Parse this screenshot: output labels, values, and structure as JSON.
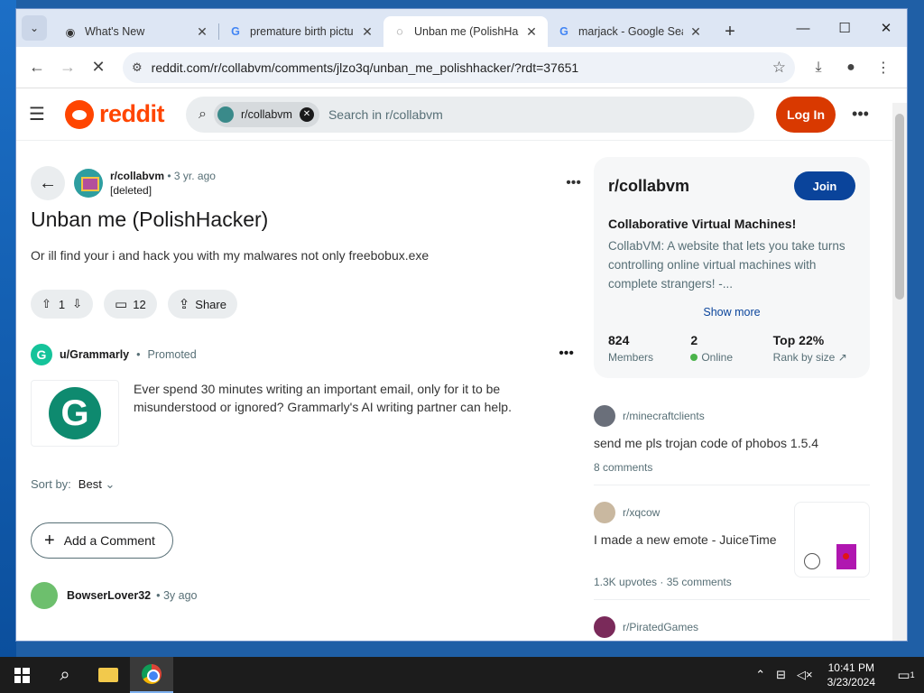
{
  "browser": {
    "tabs": [
      {
        "title": "What's New",
        "active": false
      },
      {
        "title": "premature birth pictu",
        "active": false
      },
      {
        "title": "Unban me (PolishHac",
        "active": true
      },
      {
        "title": "marjack - Google Sea",
        "active": false
      }
    ],
    "url": "reddit.com/r/collabvm/comments/jlzo3q/unban_me_polishhacker/?rdt=37651"
  },
  "reddit": {
    "logo_text": "reddit",
    "search_chip": "r/collabvm",
    "search_placeholder": "Search in r/collabvm",
    "login_label": "Log In"
  },
  "post": {
    "subreddit": "r/collabvm",
    "time": "• 3 yr. ago",
    "author": "[deleted]",
    "title": "Unban me (PolishHacker)",
    "body": "Or ill find your i and hack you with my malwares not only freebobux.exe",
    "votes": "1",
    "comments": "12",
    "share_label": "Share"
  },
  "promo": {
    "user": "u/Grammarly",
    "dot": "•",
    "tag": "Promoted",
    "logo_letter": "G",
    "text": "Ever spend 30 minutes writing an important email, only for it to be misunderstood or ignored? Grammarly's AI writing partner can help."
  },
  "sort": {
    "label": "Sort by:",
    "value": "Best"
  },
  "add_comment_label": "Add a Comment",
  "comment": {
    "user": "BowserLover32",
    "time": "• 3y ago"
  },
  "sidebar": {
    "name": "r/collabvm",
    "join_label": "Join",
    "headline": "Collaborative Virtual Machines!",
    "description": "CollabVM: A website that lets you take turns controlling online virtual machines with complete strangers! -...",
    "show_more": "Show more",
    "stats": [
      {
        "value": "824",
        "label": "Members"
      },
      {
        "value": "2",
        "label": "Online"
      },
      {
        "value": "Top 22%",
        "label": "Rank by size"
      }
    ]
  },
  "feed": [
    {
      "sub": "r/minecraftclients",
      "title": "send me pls trojan code of phobos 1.5.4",
      "meta": "8 comments",
      "avatar_color": "#6a6f7a"
    },
    {
      "sub": "r/xqcow",
      "title": "I made a new emote - JuiceTime",
      "meta": "1.3K upvotes · 35 comments",
      "avatar_color": "#c9b8a0"
    },
    {
      "sub": "r/PiratedGames",
      "title": "",
      "meta": "",
      "avatar_color": "#7a2a5a"
    }
  ],
  "taskbar": {
    "time": "10:41 PM",
    "date": "3/23/2024",
    "notif_count": "1"
  },
  "colors": {
    "reddit_orange": "#ff4500",
    "login_bg": "#d93900",
    "join_bg": "#0a449b"
  }
}
